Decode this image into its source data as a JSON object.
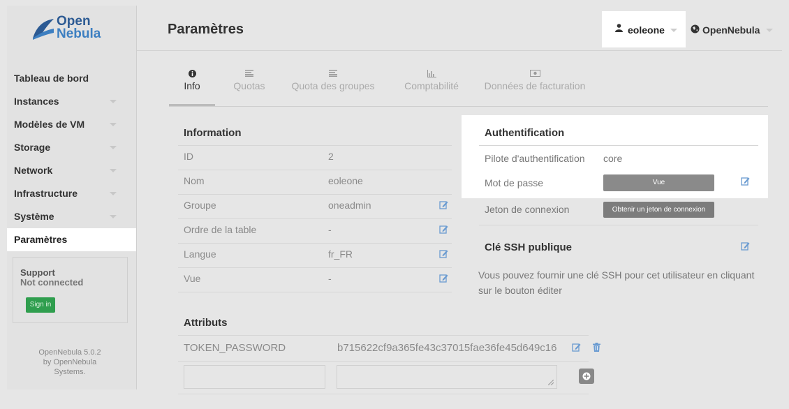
{
  "brand": {
    "logo_line1": "Open",
    "logo_line2": "Nebula"
  },
  "header": {
    "title": "Paramètres",
    "user_name": "eoleone",
    "zone_name": "OpenNebula"
  },
  "sidebar": {
    "items": [
      {
        "label": "Tableau de bord",
        "has_caret": false
      },
      {
        "label": "Instances",
        "has_caret": true
      },
      {
        "label": "Modèles de VM",
        "has_caret": true
      },
      {
        "label": "Storage",
        "has_caret": true
      },
      {
        "label": "Network",
        "has_caret": true
      },
      {
        "label": "Infrastructure",
        "has_caret": true
      },
      {
        "label": "Système",
        "has_caret": true
      },
      {
        "label": "Paramètres",
        "has_caret": false,
        "active": true
      }
    ],
    "support": {
      "title": "Support",
      "status": "Not connected",
      "sign_in": "Sign in"
    },
    "footer": {
      "line1": "OpenNebula 5.0.2",
      "line2": "by OpenNebula",
      "line3": "Systems."
    }
  },
  "tabs": [
    {
      "label": "Info",
      "icon": "info-icon",
      "active": true
    },
    {
      "label": "Quotas",
      "icon": "list-icon"
    },
    {
      "label": "Quota des groupes",
      "icon": "list-icon"
    },
    {
      "label": "Comptabilité",
      "icon": "bar-chart-icon"
    },
    {
      "label": "Données de facturation",
      "icon": "money-icon"
    }
  ],
  "info": {
    "title": "Information",
    "rows": [
      {
        "key": "ID",
        "value": "2",
        "editable": false
      },
      {
        "key": "Nom",
        "value": "eoleone",
        "editable": false
      },
      {
        "key": "Groupe",
        "value": "oneadmin",
        "editable": true
      },
      {
        "key": "Ordre de la table",
        "value": "-",
        "editable": true
      },
      {
        "key": "Langue",
        "value": "fr_FR",
        "editable": true
      },
      {
        "key": "Vue",
        "value": "-",
        "editable": true
      }
    ]
  },
  "auth": {
    "title": "Authentification",
    "driver_label": "Pilote d'authentification",
    "driver_value": "core",
    "password_label": "Mot de passe",
    "password_button": "Vue",
    "token_label": "Jeton de connexion",
    "token_button": "Obtenir un jeton de connexion"
  },
  "ssh": {
    "title": "Clé SSH publique",
    "description": "Vous pouvez fournir une clé SSH pour cet utilisateur en cliquant sur le bouton éditer"
  },
  "attributes": {
    "title": "Attributs",
    "rows": [
      {
        "key": "TOKEN_PASSWORD",
        "value": "b715622cf9a365fe43c37015fae36fe45d649c16"
      }
    ],
    "new_key_placeholder": "",
    "new_value_placeholder": ""
  },
  "colors": {
    "accent": "#2f9e4e",
    "link": "#6a9bd1",
    "brand_dark": "#2c5a93",
    "brand_light": "#3d7fc1"
  }
}
